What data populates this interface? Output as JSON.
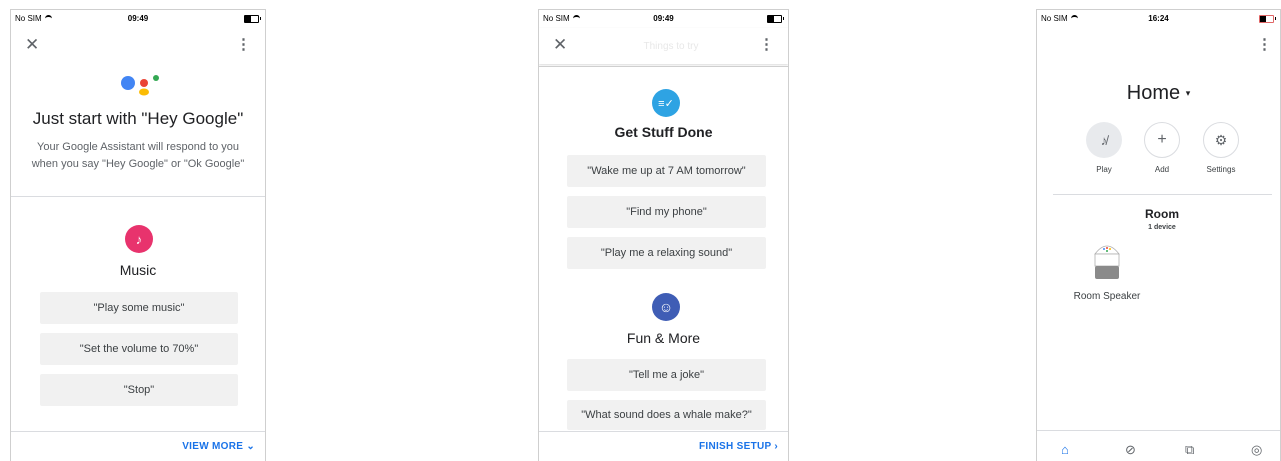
{
  "screen1": {
    "status": {
      "carrier": "No SIM",
      "time": "09:49"
    },
    "heading": "Just start with \"Hey Google\"",
    "subtext_line1": "Your Google Assistant will respond to you",
    "subtext_line2": "when you say \"Hey Google\" or \"Ok Google\"",
    "section_title": "Music",
    "chips": [
      "\"Play some music\"",
      "\"Set the volume to 70%\"",
      "\"Stop\""
    ],
    "footer_link": "VIEW MORE ⌄"
  },
  "screen2": {
    "status": {
      "carrier": "No SIM",
      "time": "09:49"
    },
    "faded_title": "Things to try",
    "section1_title": "Get Stuff Done",
    "section1_chips": [
      "\"Wake me up at 7 AM tomorrow\"",
      "\"Find my phone\"",
      "\"Play me a relaxing sound\""
    ],
    "section2_title": "Fun & More",
    "section2_chips": [
      "\"Tell me a joke\"",
      "\"What sound does a whale make?\""
    ],
    "footer_link": "FINISH SETUP ›"
  },
  "screen3": {
    "status": {
      "carrier": "No SIM",
      "time": "16:24"
    },
    "home_title": "Home",
    "actions": [
      {
        "label": "Play",
        "icon": "music-off-icon"
      },
      {
        "label": "Add",
        "icon": "plus-icon"
      },
      {
        "label": "Settings",
        "icon": "gear-icon"
      }
    ],
    "room_title": "Room",
    "room_count": "1 device",
    "device_name": "Room Speaker",
    "bottom_nav": [
      "home-icon",
      "discover-icon",
      "media-icon",
      "account-icon"
    ]
  },
  "colors": {
    "music_icon": "#e8336d",
    "tasks_icon": "#2ea3e3",
    "fun_icon": "#3f5db5",
    "link_blue": "#1a73e8"
  }
}
